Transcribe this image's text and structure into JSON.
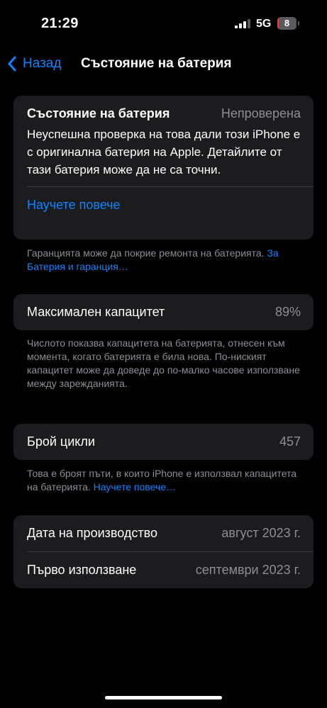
{
  "status_bar": {
    "time": "21:29",
    "network": "5G",
    "battery_level": "8",
    "battery_fraction": 0.08,
    "battery_color": "#ff3b30"
  },
  "nav": {
    "back_label": "Назад",
    "title": "Състояние на батерия"
  },
  "health_card": {
    "title": "Състояние на батерия",
    "status": "Непроверена",
    "description": "Неуспешна проверка на това дали този iPhone е с оригинална батерия на Apple. Детайлите от тази батерия може да не са точни.",
    "learn_more": "Научете повече"
  },
  "warranty_note": {
    "text": "Гаранцията може да покрие ремонта на батерията. ",
    "link": "За Батерия и гаранция…"
  },
  "max_capacity": {
    "label": "Максимален капацитет",
    "value": "89%"
  },
  "capacity_note": {
    "text": "Числото показва капацитета на батерията, отнесен към момента, когато батерията е била нова. По-ниският капацитет може да доведе до по-малко часове използване между зарежданията."
  },
  "cycle_count": {
    "label": "Брой цикли",
    "value": "457"
  },
  "cycle_note": {
    "text": "Това е броят пъти, в които iPhone е използвал капацитета на батерията. ",
    "link": "Научете повече…"
  },
  "dates": {
    "manufacture_label": "Дата на производство",
    "manufacture_value": "август 2023 г.",
    "first_use_label": "Първо използване",
    "first_use_value": "септември 2023 г."
  },
  "colors": {
    "background": "#000000",
    "card": "#1c1c1e",
    "accent": "#0a84ff",
    "secondary_text": "#8e8e93"
  }
}
